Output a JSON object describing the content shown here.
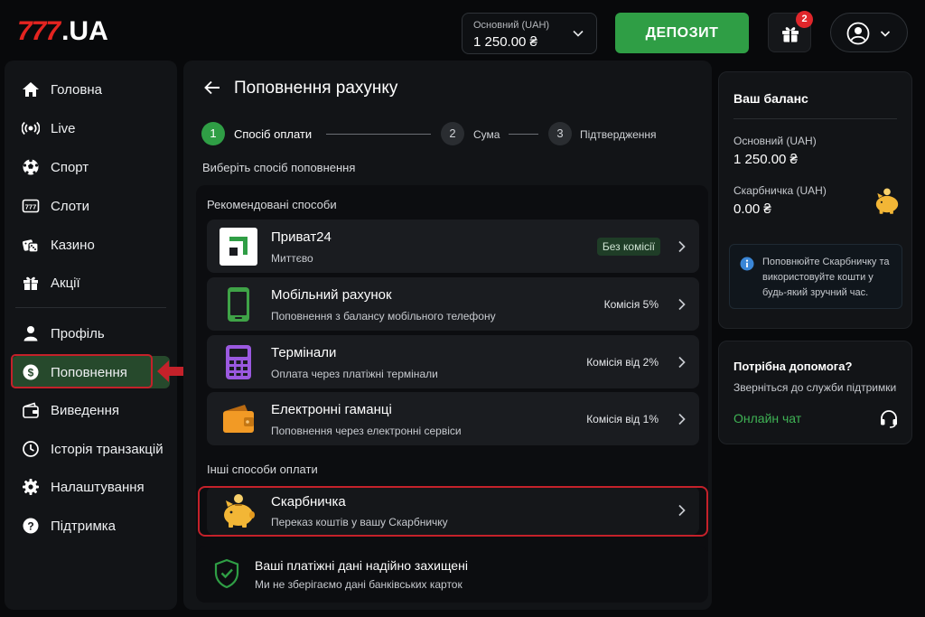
{
  "header": {
    "logo_number": "777",
    "logo_suffix": ".UA",
    "balance_label": "Основний (UAH)",
    "balance_value": "1 250.00 ₴",
    "deposit_label": "ДЕПОЗИТ",
    "gift_count": "2"
  },
  "sidebar": {
    "items": [
      {
        "label": "Головна",
        "icon": "home-icon"
      },
      {
        "label": "Live",
        "icon": "live-icon"
      },
      {
        "label": "Спорт",
        "icon": "soccer-ball-icon"
      },
      {
        "label": "Слоти",
        "icon": "slot-machine-icon"
      },
      {
        "label": "Казино",
        "icon": "dice-icon"
      },
      {
        "label": "Акції",
        "icon": "gift-icon"
      },
      {
        "label": "Профіль",
        "icon": "user-icon"
      },
      {
        "label": "Поповнення",
        "icon": "dollar-coin-icon",
        "active": true
      },
      {
        "label": "Виведення",
        "icon": "wallet-icon"
      },
      {
        "label": "Історія транзакцій",
        "icon": "history-icon"
      },
      {
        "label": "Налаштування",
        "icon": "gear-icon"
      },
      {
        "label": "Підтримка",
        "icon": "help-icon"
      }
    ]
  },
  "main": {
    "title": "Поповнення рахунку",
    "steps": [
      {
        "num": "1",
        "label": "Спосіб оплати"
      },
      {
        "num": "2",
        "label": "Сума"
      },
      {
        "num": "3",
        "label": "Підтвердження"
      }
    ],
    "choose_text": "Виберіть спосіб поповнення",
    "recommended_label": "Рекомендовані способи",
    "methods": [
      {
        "title": "Приват24",
        "subtitle": "Миттєво",
        "fee": "Без комісії",
        "icon": "privat24-icon"
      },
      {
        "title": "Мобільний рахунок",
        "subtitle": "Поповнення з балансу мобільного телефону",
        "fee": "Комісія 5%",
        "icon": "mobile-phone-icon"
      },
      {
        "title": "Термінали",
        "subtitle": "Оплата через платіжні термінали",
        "fee": "Комісія від 2%",
        "icon": "terminal-icon"
      },
      {
        "title": "Електронні гаманці",
        "subtitle": "Поповнення через електронні сервіси",
        "fee": "Комісія від 1%",
        "icon": "e-wallet-icon"
      }
    ],
    "other_label": "Інші способи оплати",
    "piggy": {
      "title": "Скарбничка",
      "subtitle": "Переказ коштів у вашу Скарбничку",
      "icon": "piggy-bank-icon"
    },
    "secure": {
      "title": "Ваші платіжні дані надійно захищені",
      "subtitle": "Ми не зберігаємо дані банківських карток"
    }
  },
  "balance_card": {
    "title": "Ваш баланс",
    "main_label": "Основний (UAH)",
    "main_value": "1 250.00 ₴",
    "piggy_label": "Скарбничка (UAH)",
    "piggy_value": "0.00 ₴",
    "info": "Поповнюйте Скарбничку та використовуйте кошти у будь-який зручний час."
  },
  "help_card": {
    "title": "Потрібна допомога?",
    "subtitle": "Зверніться до служби підтримки",
    "chat_label": "Онлайн чат"
  },
  "colors": {
    "accent_green": "#2f9e45",
    "highlight_red": "#c4212a",
    "logo_red": "#e42420"
  }
}
